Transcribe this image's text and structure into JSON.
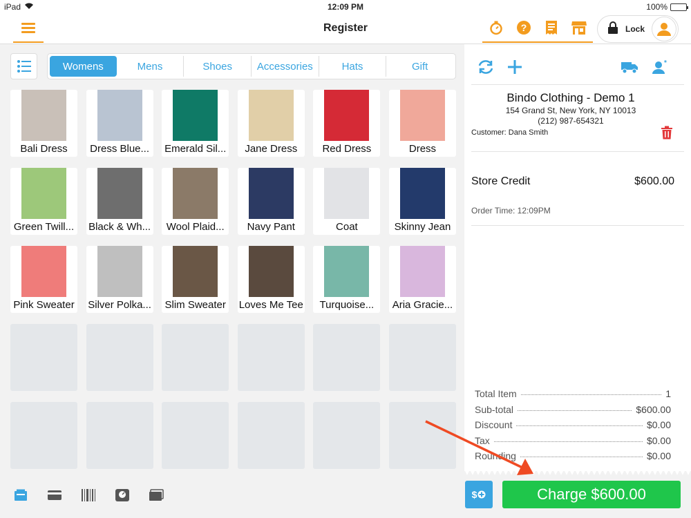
{
  "status_bar": {
    "device": "iPad",
    "time": "12:09 PM",
    "battery": "100%"
  },
  "header": {
    "title": "Register",
    "lock_label": "Lock"
  },
  "categories": [
    {
      "label": "Womens",
      "active": true
    },
    {
      "label": "Mens",
      "active": false
    },
    {
      "label": "Shoes",
      "active": false
    },
    {
      "label": "Accessories",
      "active": false
    },
    {
      "label": "Hats",
      "active": false
    },
    {
      "label": "Gift",
      "active": false
    }
  ],
  "products": [
    {
      "name": "Bali Dress",
      "color": "#c9c0b8"
    },
    {
      "name": "Dress Blue...",
      "color": "#b9c4d2"
    },
    {
      "name": "Emerald Sil...",
      "color": "#0f7a66"
    },
    {
      "name": "Jane Dress",
      "color": "#e1cfa8"
    },
    {
      "name": "Red Dress",
      "color": "#d52a36"
    },
    {
      "name": "Dress",
      "color": "#f0a89a"
    },
    {
      "name": "Green Twill...",
      "color": "#9dc87a"
    },
    {
      "name": "Black & Wh...",
      "color": "#6e6e6e"
    },
    {
      "name": "Wool Plaid...",
      "color": "#8b7a68"
    },
    {
      "name": "Navy Pant",
      "color": "#2c3a63"
    },
    {
      "name": "Coat",
      "color": "#e2e3e6"
    },
    {
      "name": "Skinny Jean",
      "color": "#233a6b"
    },
    {
      "name": "Pink Sweater",
      "color": "#ef7c7a"
    },
    {
      "name": "Silver Polka...",
      "color": "#bfbfbf"
    },
    {
      "name": "Slim Sweater",
      "color": "#6a5746"
    },
    {
      "name": "Loves Me Tee",
      "color": "#5a4a3e"
    },
    {
      "name": "Turquoise...",
      "color": "#78b7a8"
    },
    {
      "name": "Aria Gracie...",
      "color": "#d9b7dd"
    }
  ],
  "empty_tiles": 12,
  "receipt": {
    "store_name": "Bindo Clothing - Demo 1",
    "address": "154 Grand St, New York, NY 10013",
    "phone": "(212) 987-654321",
    "customer": "Customer: Dana Smith",
    "item_name": "Store Credit",
    "item_price": "$600.00",
    "order_time": "Order Time: 12:09PM",
    "totals": [
      {
        "label": "Total Item",
        "value": "1"
      },
      {
        "label": "Sub-total",
        "value": "$600.00"
      },
      {
        "label": "Discount",
        "value": "$0.00"
      },
      {
        "label": "Tax",
        "value": "$0.00"
      },
      {
        "label": "Rounding",
        "value": "$0.00"
      }
    ]
  },
  "actions": {
    "charge_label": "Charge $600.00",
    "cash_label": "$"
  },
  "colors": {
    "accent_orange": "#f39c1f",
    "accent_blue": "#3aa5e0",
    "charge_green": "#1fc64b",
    "danger_red": "#e2383a"
  }
}
